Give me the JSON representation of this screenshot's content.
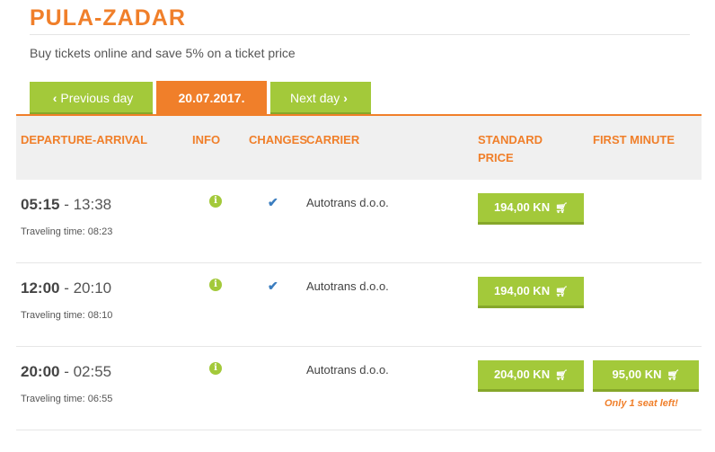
{
  "page": {
    "title": "PULA-ZADAR",
    "subtitle": "Buy tickets online and save 5% on a ticket price"
  },
  "date_nav": {
    "previous_label": "Previous day",
    "current_date": "20.07.2017.",
    "next_label": "Next day",
    "prev_icon": "‹",
    "next_icon": "›"
  },
  "table": {
    "headers": {
      "departure_arrival": "DEPARTURE-ARRIVAL",
      "info": "INFO",
      "changes": "CHANGES",
      "carrier": "CARRIER",
      "standard_price_1": "STANDARD",
      "standard_price_2": "PRICE",
      "first_minute": "FIRST MINUTE"
    },
    "rows": [
      {
        "departure": "05:15",
        "arrival": " - 13:38",
        "traveling_time": "Traveling time: 08:23",
        "carrier": "Autotrans d.o.o.",
        "has_changes": true,
        "standard_price": "194,00 KN",
        "first_minute_price": null,
        "first_minute_note": null
      },
      {
        "departure": "12:00",
        "arrival": " - 20:10",
        "traveling_time": "Traveling time: 08:10",
        "carrier": "Autotrans d.o.o.",
        "has_changes": true,
        "standard_price": "194,00 KN",
        "first_minute_price": null,
        "first_minute_note": null
      },
      {
        "departure": "20:00",
        "arrival": " - 02:55",
        "traveling_time": "Traveling time: 06:55",
        "carrier": "Autotrans d.o.o.",
        "has_changes": false,
        "standard_price": "204,00 KN",
        "first_minute_price": "95,00 KN",
        "first_minute_note": "Only 1 seat left!"
      }
    ]
  },
  "icons": {
    "info": "info-icon",
    "check": "check-icon",
    "cart": "cart-icon",
    "info_glyph": "i",
    "check_glyph": "✔",
    "cart_glyph": "🛒"
  },
  "colors": {
    "brand_orange": "#f07f2a",
    "brand_green": "#a3c93a",
    "check_blue": "#3b7dbf"
  }
}
